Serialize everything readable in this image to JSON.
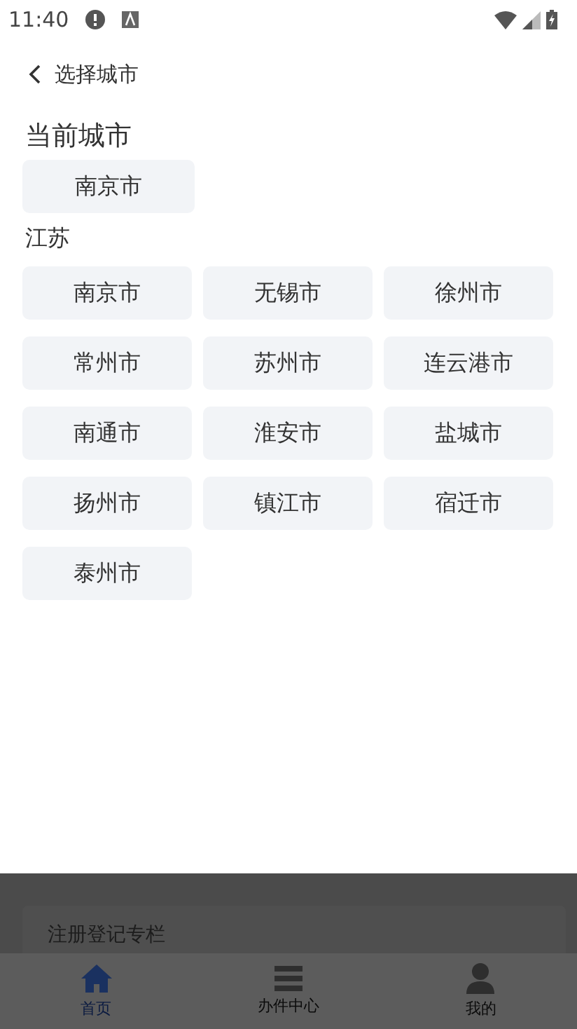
{
  "status_bar": {
    "time": "11:40"
  },
  "header": {
    "title": "选择城市"
  },
  "current_city": {
    "heading": "当前城市",
    "city": "南京市"
  },
  "province": {
    "heading": "江苏",
    "cities": [
      "南京市",
      "无锡市",
      "徐州市",
      "常州市",
      "苏州市",
      "连云港市",
      "南通市",
      "淮安市",
      "盐城市",
      "扬州市",
      "镇江市",
      "宿迁市",
      "泰州市"
    ]
  },
  "background_page": {
    "card_title": "注册登记专栏"
  },
  "tab_bar": [
    {
      "label": "首页",
      "kind": "home",
      "selected": true
    },
    {
      "label": "办件中心",
      "kind": "list",
      "selected": false
    },
    {
      "label": "我的",
      "kind": "person",
      "selected": false
    }
  ]
}
